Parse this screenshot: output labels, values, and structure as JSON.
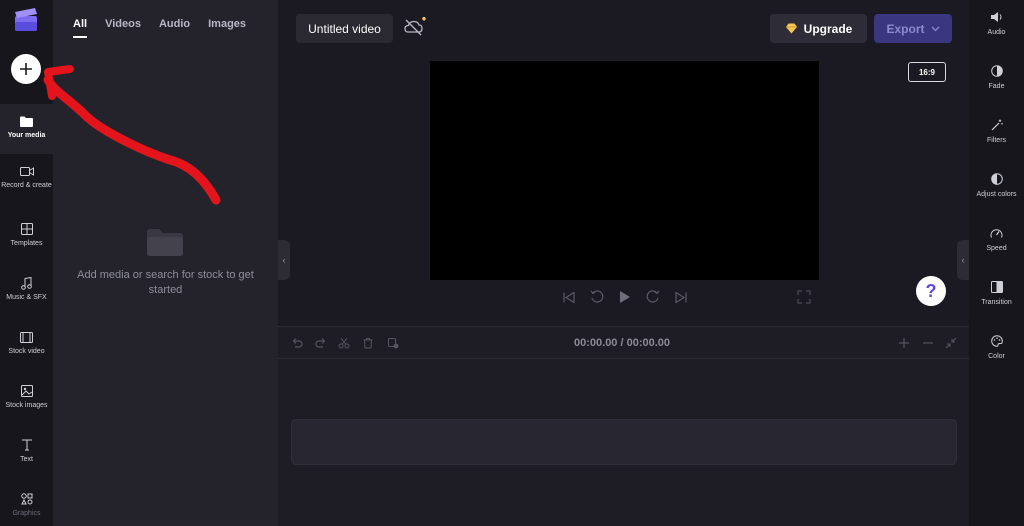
{
  "left_rail": {
    "items": [
      {
        "label": "Your media",
        "icon": "folder-icon"
      },
      {
        "label": "Record & create",
        "icon": "camera-icon"
      },
      {
        "label": "Templates",
        "icon": "templates-icon"
      },
      {
        "label": "Music & SFX",
        "icon": "music-icon"
      },
      {
        "label": "Stock video",
        "icon": "film-icon"
      },
      {
        "label": "Stock images",
        "icon": "image-icon"
      },
      {
        "label": "Text",
        "icon": "text-icon"
      },
      {
        "label": "Graphics",
        "icon": "shapes-icon"
      }
    ]
  },
  "media_panel": {
    "tabs": [
      "All",
      "Videos",
      "Audio",
      "Images"
    ],
    "active_tab": "All",
    "empty_message": "Add media or search for stock to get started"
  },
  "top_bar": {
    "title": "Untitled video",
    "upgrade_label": "Upgrade",
    "export_label": "Export"
  },
  "preview": {
    "aspect_ratio": "16:9"
  },
  "timeline": {
    "current_time": "00:00.00",
    "separator": " / ",
    "total_time": "00:00.00"
  },
  "right_rail": {
    "items": [
      {
        "label": "Audio",
        "icon": "speaker-icon"
      },
      {
        "label": "Fade",
        "icon": "fade-icon"
      },
      {
        "label": "Filters",
        "icon": "magic-wand-icon"
      },
      {
        "label": "Adjust colors",
        "icon": "contrast-icon"
      },
      {
        "label": "Speed",
        "icon": "speedometer-icon"
      },
      {
        "label": "Transition",
        "icon": "transition-icon"
      },
      {
        "label": "Color",
        "icon": "palette-icon"
      }
    ]
  },
  "help": {
    "label": "?"
  },
  "colors": {
    "accent": "#3a3680",
    "annotation": "#e3141b",
    "upgrade_diamond": "#f5c451"
  }
}
